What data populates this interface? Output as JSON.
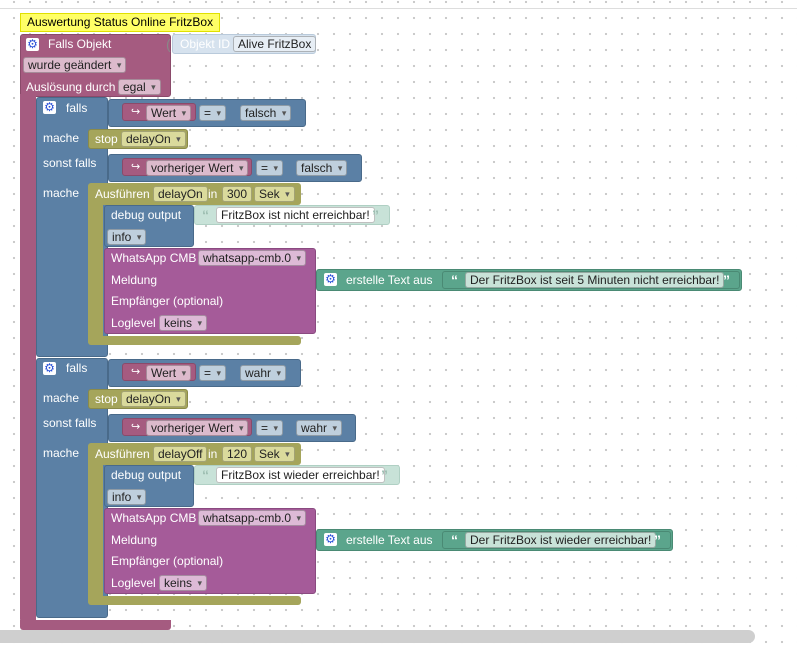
{
  "comment": {
    "text": "Auswertung Status Online FritzBox"
  },
  "trigger": {
    "label": "Falls Objekt",
    "object_id_label": "Objekt ID",
    "object_id_value": "Alive FritzBox",
    "change_mode": "wurde geändert",
    "trigger_by_label": "Auslösung durch",
    "trigger_by_value": "egal"
  },
  "labels": {
    "falls": "falls",
    "mache": "mache",
    "sonst_falls": "sonst falls",
    "stop": "stop",
    "ausfuehren": "Ausführen",
    "in": "in",
    "debug_output": "debug output",
    "whatsapp": "WhatsApp CMB",
    "meldung": "Meldung",
    "empfaenger": "Empfänger (optional)",
    "loglevel": "Loglevel",
    "erstelle_text": "erstelle Text aus",
    "eq": "="
  },
  "block1": {
    "cond1_var": "Wert",
    "cond1_val": "falsch",
    "stop_timer": "delayOn",
    "cond2_var": "vorheriger Wert",
    "cond2_val": "falsch",
    "timer_name": "delayOn",
    "timer_value": "300",
    "timer_unit": "Sek",
    "debug_text": "FritzBox ist nicht erreichbar!",
    "debug_level": "info",
    "wa_instance": "whatsapp-cmb.0",
    "message": "Der FritzBox ist seit 5 Minuten nicht erreichbar!",
    "loglevel": "keins"
  },
  "block2": {
    "cond1_var": "Wert",
    "cond1_val": "wahr",
    "stop_timer": "delayOn",
    "cond2_var": "vorheriger Wert",
    "cond2_val": "wahr",
    "timer_name": "delayOff",
    "timer_value": "120",
    "timer_unit": "Sek",
    "debug_text": "FritzBox ist wieder erreichbar!",
    "debug_level": "info",
    "wa_instance": "whatsapp-cmb.0",
    "message": "Der FritzBox ist wieder erreichbar!",
    "loglevel": "keins"
  },
  "icons": {
    "gear": "gear-icon",
    "arrow": "variable-arrow-icon",
    "quote": "quote-icon"
  },
  "colors": {
    "event": "#a55b80",
    "logic": "#5b80a5",
    "timer": "#a5a55b",
    "command": "#a55b99",
    "text": "#5ba58c",
    "comment": "#ffff66"
  }
}
